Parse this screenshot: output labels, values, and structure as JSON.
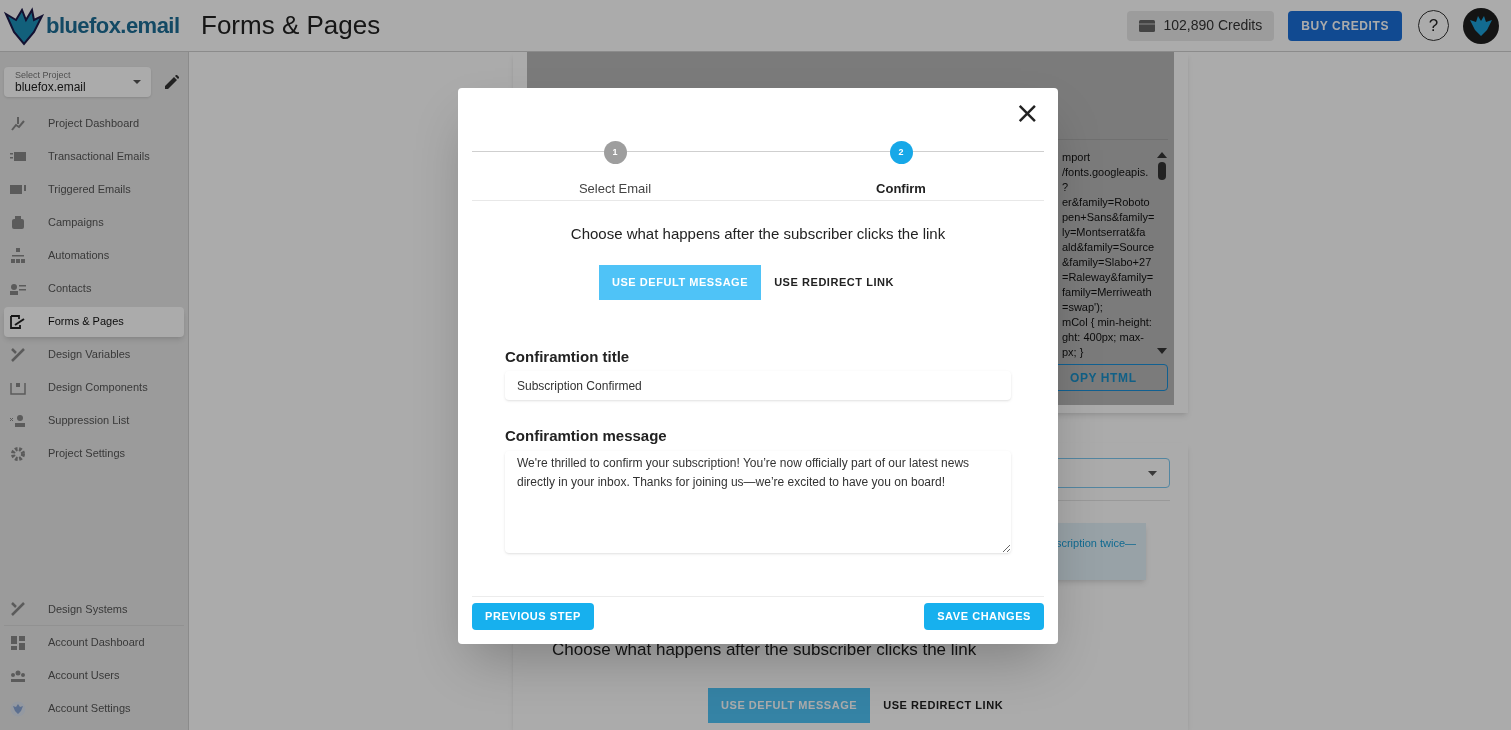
{
  "header": {
    "logo_text": "bluefox.email",
    "title": "Forms & Pages",
    "credits": "102,890 Credits",
    "buy_button": "BUY CREDITS",
    "help": "?"
  },
  "sidebar": {
    "project_select": {
      "label": "Select Project",
      "value": "bluefox.email"
    },
    "nav_items": [
      {
        "label": "Project Dashboard",
        "selected": false
      },
      {
        "label": "Transactional Emails",
        "selected": false
      },
      {
        "label": "Triggered Emails",
        "selected": false
      },
      {
        "label": "Campaigns",
        "selected": false
      },
      {
        "label": "Automations",
        "selected": false
      },
      {
        "label": "Contacts",
        "selected": false
      },
      {
        "label": "Forms & Pages",
        "selected": true
      },
      {
        "label": "Design Variables",
        "selected": false
      },
      {
        "label": "Design Components",
        "selected": false
      },
      {
        "label": "Suppression List",
        "selected": false
      },
      {
        "label": "Project Settings",
        "selected": false
      }
    ],
    "bottom_items": [
      {
        "label": "Design Systems"
      },
      {
        "label": "Account Dashboard"
      },
      {
        "label": "Account Users"
      },
      {
        "label": "Account Settings"
      }
    ]
  },
  "background": {
    "code_lines": [
      "mport",
      "/fonts.googleapis.",
      "?",
      "er&family=Roboto",
      "pen+Sans&family=",
      "ly=Montserrat&fa",
      "ald&family=Source",
      "&family=Slabo+27",
      "=Raleway&family=",
      "family=Merriweath",
      "=swap');",
      "mCol { min-height:",
      "ght: 400px; max-",
      "px; }"
    ],
    "copy_button": "OPY HTML",
    "notice": "scription twice—",
    "heading": "Choose what happens after the subscriber clicks the link",
    "toggles": [
      {
        "label": "USE DEFULT MESSAGE",
        "selected": true
      },
      {
        "label": "USE REDIRECT LINK",
        "selected": false
      }
    ]
  },
  "modal": {
    "close": "×",
    "steps": [
      {
        "number": "1",
        "label": "Select Email",
        "selected": false
      },
      {
        "number": "2",
        "label": "Confirm",
        "selected": true
      }
    ],
    "heading": "Choose what happens after the subscriber clicks the link",
    "toggles": [
      {
        "label": "USE DEFULT MESSAGE",
        "selected": true
      },
      {
        "label": "USE REDIRECT LINK",
        "selected": false
      }
    ],
    "fields": [
      {
        "kind": "input",
        "label": "Confiramtion title",
        "value": "Subscription Confirmed"
      },
      {
        "kind": "textarea",
        "label": "Confiramtion message",
        "value": "We're thrilled to confirm your subscription! You’re now officially part of our latest news directly in your inbox. Thanks for joining us—we’re excited to have you on board!"
      }
    ],
    "previous_button": "PREVIOUS STEP",
    "save_button": "SAVE CHANGES"
  }
}
